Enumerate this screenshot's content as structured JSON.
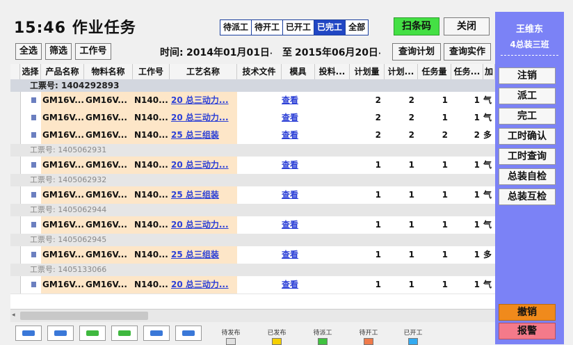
{
  "header": {
    "title": "15:46 作业任务",
    "tabs": [
      {
        "label": "待派工",
        "active": false
      },
      {
        "label": "待开工",
        "active": false
      },
      {
        "label": "已开工",
        "active": false
      },
      {
        "label": "已完工",
        "active": true
      },
      {
        "label": "全部",
        "active": false
      }
    ],
    "scan_label": "扫条码",
    "close_label": "关闭"
  },
  "toolbar": {
    "select_all": "全选",
    "filter": "筛选",
    "work_no": "工作号",
    "time_label": "时间:",
    "date_from": "2014年01月01日",
    "to_label": "至",
    "date_to": "2015年06月20日",
    "query_plan": "查询计划",
    "query_actual": "查询实作"
  },
  "table": {
    "columns": [
      "选择",
      "产品名称",
      "物料名称",
      "工作号",
      "工艺名称",
      "技术文件",
      "模具",
      "投料...",
      "计划量",
      "计划...",
      "任务量",
      "任务...",
      "加"
    ],
    "groups": [
      {
        "label": "工票号: 1405062931",
        "rows": [
          [
            "GM16V...",
            "GM16V...",
            "N140...",
            "20 总三动力...",
            "查看",
            "1",
            "1",
            "1",
            "1",
            "气"
          ]
        ]
      },
      {
        "label": "工票号: 1405062932",
        "rows": [
          [
            "GM16V...",
            "GM16V...",
            "N140...",
            "25 总三组装",
            "查看",
            "1",
            "1",
            "1",
            "1",
            "气"
          ]
        ]
      },
      {
        "label": "工票号: 1405062944",
        "rows": [
          [
            "GM16V...",
            "GM16V...",
            "N140...",
            "20 总三动力...",
            "查看",
            "1",
            "1",
            "1",
            "1",
            "气"
          ]
        ]
      },
      {
        "label": "工票号: 1405062945",
        "rows": [
          [
            "GM16V...",
            "GM16V...",
            "N140...",
            "25 总三组装",
            "查看",
            "1",
            "1",
            "1",
            "1",
            "多"
          ]
        ]
      },
      {
        "label": "工票号: 1405133066",
        "rows": [
          [
            "GM16V...",
            "GM16V...",
            "N140...",
            "20 总三动力...",
            "查看",
            "1",
            "1",
            "1",
            "1",
            "气"
          ]
        ]
      }
    ],
    "first_group": {
      "label": "工票号: 1404292893",
      "rows": [
        [
          "GM16V...",
          "GM16V...",
          "N140...",
          "20 总三动力...",
          "查看",
          "2",
          "2",
          "1",
          "1",
          "气"
        ],
        [
          "GM16V...",
          "GM16V...",
          "N140...",
          "20 总三动力...",
          "查看",
          "2",
          "2",
          "1",
          "1",
          "气"
        ],
        [
          "GM16V...",
          "GM16V...",
          "N140...",
          "25 总三组装",
          "查看",
          "2",
          "2",
          "2",
          "2",
          "多"
        ]
      ]
    }
  },
  "legend": [
    "待发布",
    "已发布",
    "待派工",
    "待开工",
    "已开工"
  ],
  "legend_colors": [
    "#e0e0e0",
    "#f5d000",
    "#3fc23f",
    "#f07a4a",
    "#33aaf0"
  ],
  "sidebar": {
    "user": "王维东",
    "team": "4总装三班",
    "buttons": [
      "注销",
      "派工",
      "完工",
      "工时确认",
      "工时查询",
      "总装自检",
      "总装互检"
    ],
    "cancel": "撤销",
    "report": "报警"
  }
}
